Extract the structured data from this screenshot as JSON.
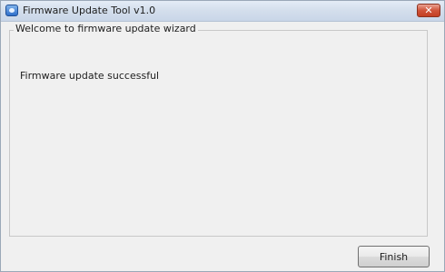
{
  "window": {
    "title": "Firmware Update Tool v1.0",
    "close_symbol": "✕",
    "icon": "app-icon"
  },
  "wizard": {
    "group_title": "Welcome to firmware update wizard",
    "status_message": "Firmware update successful"
  },
  "footer": {
    "finish_label": "Finish"
  },
  "colors": {
    "titlebar": "#d3deec",
    "close_button": "#c43f23",
    "window_bg": "#f0f0f0"
  }
}
